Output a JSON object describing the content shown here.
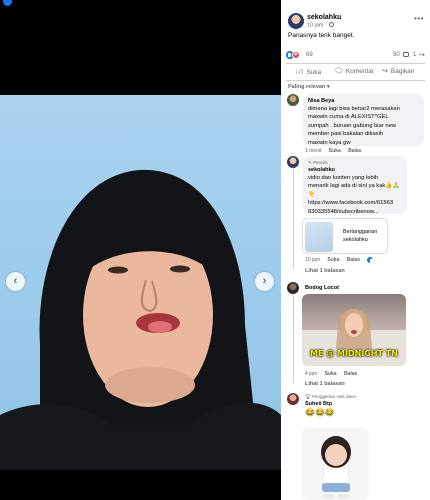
{
  "post": {
    "page_name": "sekolahku",
    "time": "10 jam",
    "caption": "Panasnya terik banget.",
    "reaction_count": "69",
    "comment_count": "50",
    "share_count": "1"
  },
  "actions": {
    "like": "Suka",
    "comment": "Komentar",
    "share": "Bagikan"
  },
  "filter_label": "Paling relevan",
  "comments": [
    {
      "name": "Nisa Beya",
      "text": "dimana lagi bisa benar2 merasakan\nmaxwin cuma di ALEXIST*GEL\nsumpah . buruan gabung biar new\nmember pasi bakalan dikasih\nmaxwin kaya gw",
      "time": "1 menit",
      "like": "Suka",
      "reply": "Balas"
    },
    {
      "pinned_label": "Penulis",
      "name": "sekolahku",
      "text": "vidio dan konten yang lebih\nmenarik lagi ada di sini ya kak👍🙏\n👇",
      "link": "https://www.facebook.com/61563\n830335548/subscribenow...",
      "card_text": "Berlangganan\nsekolahku",
      "time": "10 jam",
      "like": "Suka",
      "reply": "Balas",
      "replies": "Lihat 1 balasan"
    },
    {
      "name": "Bodog Locot",
      "gif_caption": "ME @ MIDNIGHT TN",
      "time": "4 jam",
      "like": "Suka",
      "reply": "Balas",
      "replies": "Lihat 1 balasan"
    },
    {
      "badge": "Penggemar naik daun",
      "name": "Suheii Btp",
      "emojis": "😂😂😂"
    }
  ],
  "icons": {
    "prev": "chevron-left-icon",
    "next": "chevron-right-icon",
    "globe": "globe-icon",
    "more": "more-icon",
    "like_reaction": "like-reaction-icon",
    "love_reaction": "love-reaction-icon"
  },
  "colors": {
    "accent": "#1877f2",
    "love": "#f33e58",
    "secondary_text": "#65676b",
    "bubble": "#f0f2f5"
  }
}
